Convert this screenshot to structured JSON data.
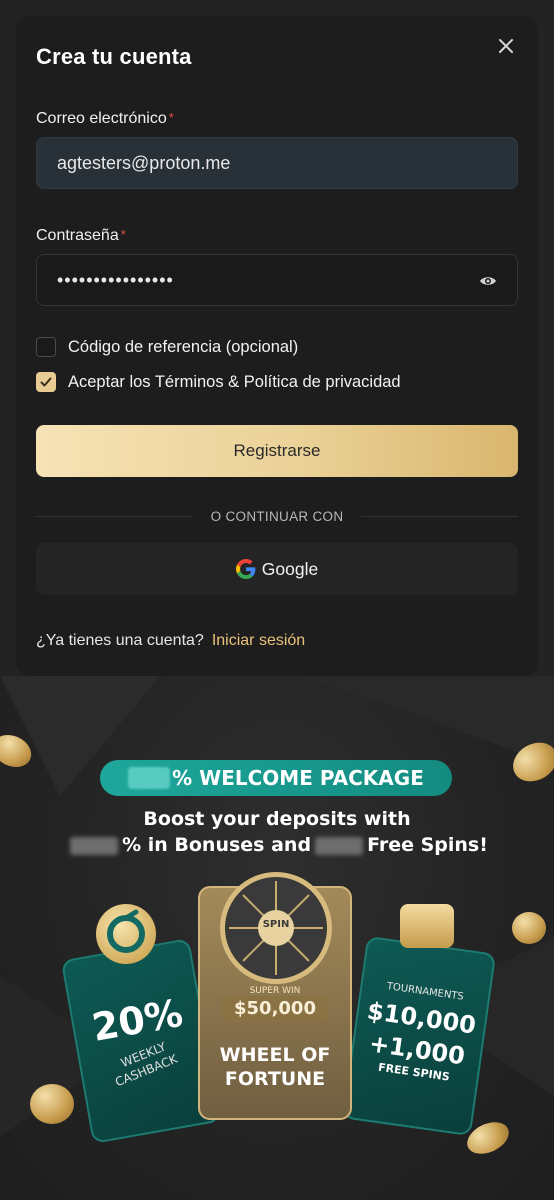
{
  "modal": {
    "title": "Crea tu cuenta",
    "email_label": "Correo electrónico",
    "email_value": "agtesters@proton.me",
    "password_label": "Contraseña",
    "password_value": "••••••••••••••••",
    "required_mark": "*",
    "referral_label": "Código de referencia (opcional)",
    "terms_label": "Aceptar los Términos & Política de privacidad",
    "referral_checked": false,
    "terms_checked": true,
    "register_button": "Registrarse",
    "divider_text": "O CONTINUAR CON",
    "google_button": "Google",
    "have_account_text": "¿Ya tienes una cuenta?",
    "login_link": "Iniciar sesión"
  },
  "promo": {
    "welcome": "% WELCOME PACKAGE",
    "boost_line1": "Boost your deposits with",
    "boost_line2a": "% in Bonuses and",
    "boost_line2b": "Free Spins!",
    "cashback_pct": "20%",
    "cashback_label1": "WEEKLY",
    "cashback_label2": "CASHBACK",
    "wheel_spin": "SPIN",
    "super_win": "SUPER WIN",
    "super_win_amount": "$50,000",
    "wheel_title1": "WHEEL OF",
    "wheel_title2": "FORTUNE",
    "tournaments": "TOURNAMENTS",
    "tourn_amount": "$10,000",
    "tourn_spins": "+1,000",
    "tourn_spins_label": "FREE SPINS"
  },
  "colors": {
    "accent_gold": "#e8c27a",
    "teal": "#1ea79b",
    "card_bg": "#1d1d1d"
  }
}
